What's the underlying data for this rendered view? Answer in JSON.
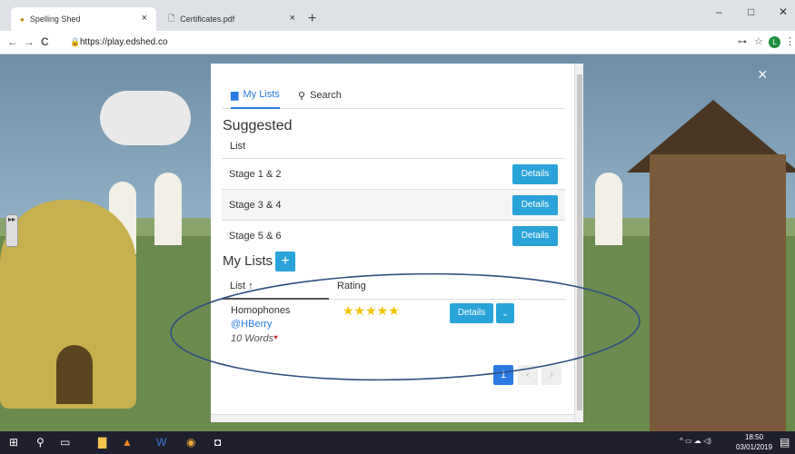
{
  "browser": {
    "tabs": [
      {
        "title": "Spelling Shed",
        "close": "×"
      },
      {
        "title": "Certificates.pdf",
        "close": "×"
      }
    ],
    "new_tab": "+",
    "window_controls": {
      "minimize": "–",
      "maximize": "□",
      "close": "✕"
    },
    "nav": {
      "back": "←",
      "forward": "→",
      "reload": "C"
    },
    "url": "https://play.edshed.co",
    "profile_initial": "L"
  },
  "page": {
    "close_label": "×",
    "side_handle": "▸▸"
  },
  "modal": {
    "tabs": [
      {
        "label": "My Lists",
        "icon": "document-icon"
      },
      {
        "label": "Search",
        "icon": "search-icon"
      }
    ],
    "suggested": {
      "heading": "Suggested",
      "column": "List",
      "rows": [
        {
          "name": "Stage 1 & 2",
          "button": "Details"
        },
        {
          "name": "Stage 3 & 4",
          "button": "Details"
        },
        {
          "name": "Stage 5 & 6",
          "button": "Details"
        }
      ]
    },
    "my_lists": {
      "heading": "My Lists",
      "add_label": "+",
      "columns": {
        "list": "List ↑",
        "rating": "Rating"
      },
      "item": {
        "name": "Homophones",
        "author": "@HBerry",
        "words": "10 Words",
        "rating": 5,
        "stars": "★★★★★",
        "details_button": "Details",
        "caret": "⌄"
      },
      "pagination": {
        "current": "1",
        "prev": "‹",
        "next": "›"
      }
    }
  },
  "taskbar": {
    "time": "18:50",
    "date": "03/01/2019"
  },
  "colors": {
    "accent_blue": "#29a3d8",
    "link_blue": "#2a7ae2",
    "star_yellow": "#f2c200",
    "annotation_oval": "#2f4f7f"
  }
}
